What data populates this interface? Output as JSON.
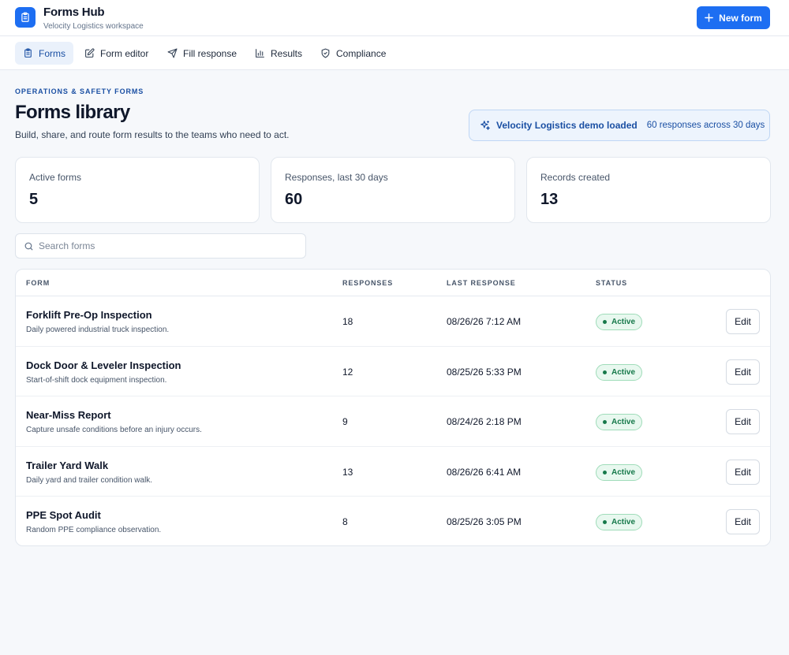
{
  "app": {
    "title": "Forms Hub",
    "subtitle": "Velocity Logistics workspace",
    "new_form_label": "New form",
    "accent": "#1d6ef2"
  },
  "nav": {
    "tabs": [
      {
        "label": "Forms",
        "icon": "clipboard-icon",
        "active": true
      },
      {
        "label": "Form editor",
        "icon": "edit-icon",
        "active": false
      },
      {
        "label": "Fill response",
        "icon": "send-icon",
        "active": false
      },
      {
        "label": "Results",
        "icon": "bar-chart-icon",
        "active": false
      },
      {
        "label": "Compliance",
        "icon": "shield-icon",
        "active": false
      }
    ]
  },
  "hero": {
    "eyebrow": "OPERATIONS & SAFETY FORMS",
    "title": "Forms library",
    "description": "Build, share, and route form results to the teams who need to act.",
    "demo_title": "Velocity Logistics demo loaded",
    "demo_sub": "60 responses across 30 days"
  },
  "stats": [
    {
      "label": "Active forms",
      "value": "5"
    },
    {
      "label": "Responses, last 30 days",
      "value": "60"
    },
    {
      "label": "Records created",
      "value": "13"
    }
  ],
  "search": {
    "placeholder": "Search forms",
    "value": ""
  },
  "table": {
    "headers": {
      "form": "FORM",
      "responses": "RESPONSES",
      "last_response": "LAST RESPONSE",
      "status": "STATUS"
    },
    "edit_label": "Edit",
    "rows": [
      {
        "name": "Forklift Pre-Op Inspection",
        "description": "Daily powered industrial truck inspection.",
        "responses": "18",
        "last_response": "08/26/26 7:12 AM",
        "status": "Active"
      },
      {
        "name": "Dock Door & Leveler Inspection",
        "description": "Start-of-shift dock equipment inspection.",
        "responses": "12",
        "last_response": "08/25/26 5:33 PM",
        "status": "Active"
      },
      {
        "name": "Near-Miss Report",
        "description": "Capture unsafe conditions before an injury occurs.",
        "responses": "9",
        "last_response": "08/24/26 2:18 PM",
        "status": "Active"
      },
      {
        "name": "Trailer Yard Walk",
        "description": "Daily yard and trailer condition walk.",
        "responses": "13",
        "last_response": "08/26/26 6:41 AM",
        "status": "Active"
      },
      {
        "name": "PPE Spot Audit",
        "description": "Random PPE compliance observation.",
        "responses": "8",
        "last_response": "08/25/26 3:05 PM",
        "status": "Active"
      }
    ]
  },
  "colors": {
    "status_active": "#16794a",
    "primary": "#1d6ef2",
    "nav_active": "#1a4fa3"
  }
}
